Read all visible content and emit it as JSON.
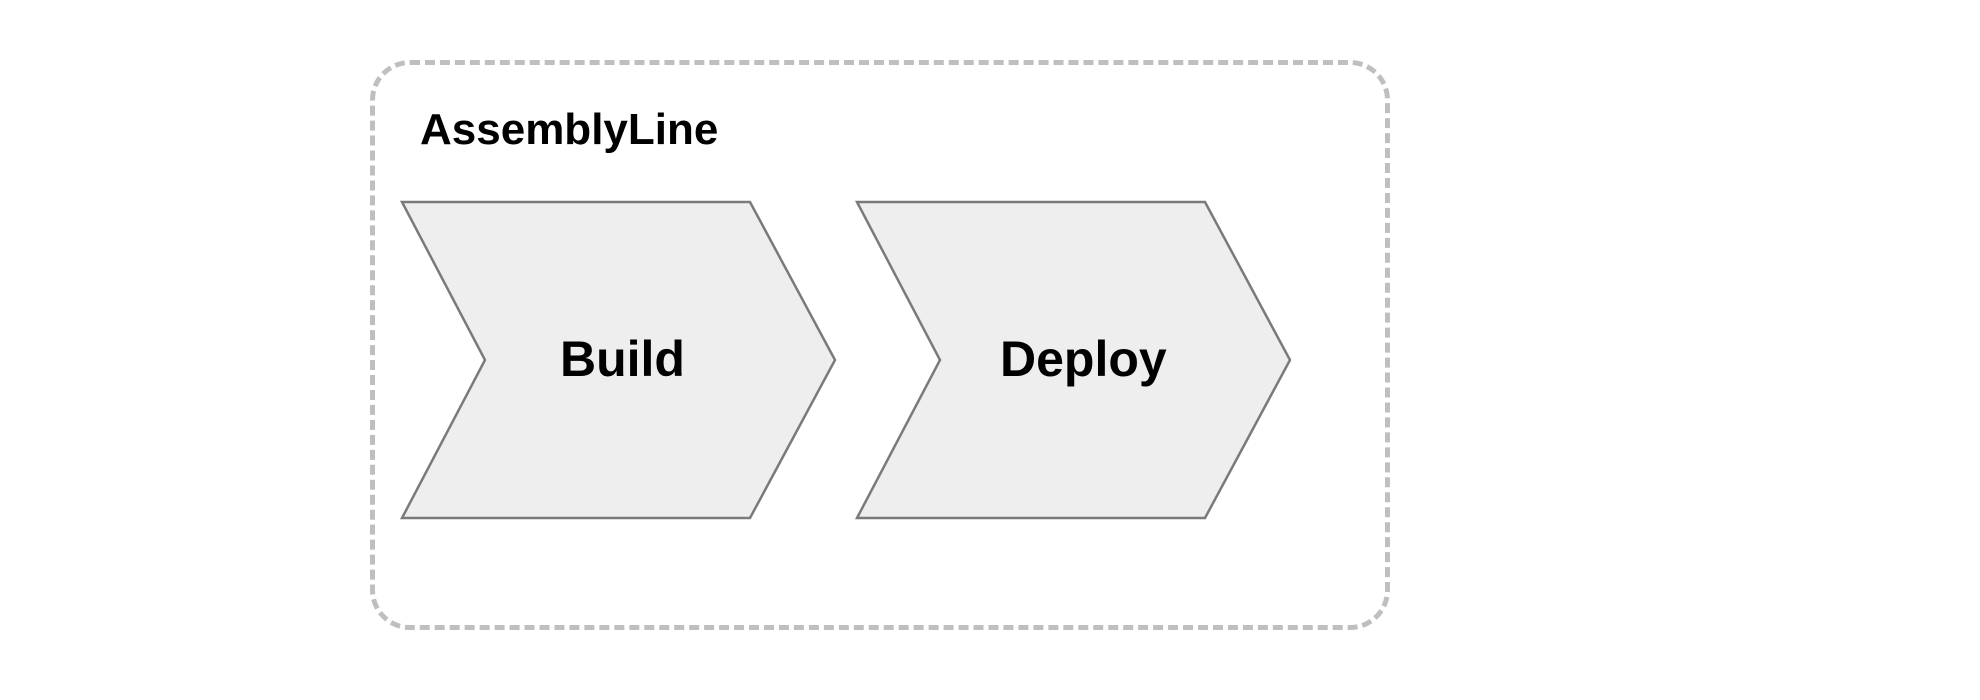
{
  "diagram": {
    "container_label": "AssemblyLine",
    "stages": [
      "Build",
      "Deploy"
    ],
    "colors": {
      "chevron_fill": "#eeeeee",
      "chevron_stroke": "#7a7a7a",
      "container_border": "#bfbfbf",
      "text": "#000000"
    }
  }
}
